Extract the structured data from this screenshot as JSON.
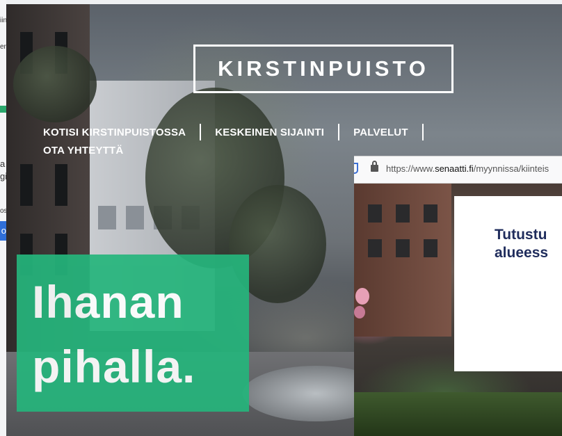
{
  "underlying_page": {
    "snippets": [
      "iin",
      "er",
      "a",
      "gi",
      "os",
      "o"
    ]
  },
  "hero": {
    "logo_text": "KIRSTINPUISTO",
    "nav": [
      "KOTISI KIRSTINPUISTOSSA",
      "KESKEINEN SIJAINTI",
      "PALVELUT",
      "OTA YHTEYTTÄ"
    ],
    "headline": [
      "Ihanan",
      "pihalla."
    ],
    "headline_color": "#25b57c"
  },
  "overlay_browser": {
    "url_prefix": "https://www.",
    "url_domain": "senaatti.fi",
    "url_suffix": "/myynnissa/kiinteis",
    "card_lines": [
      "Tutustu",
      "alueess"
    ],
    "card_text_color": "#1f2c5c"
  }
}
